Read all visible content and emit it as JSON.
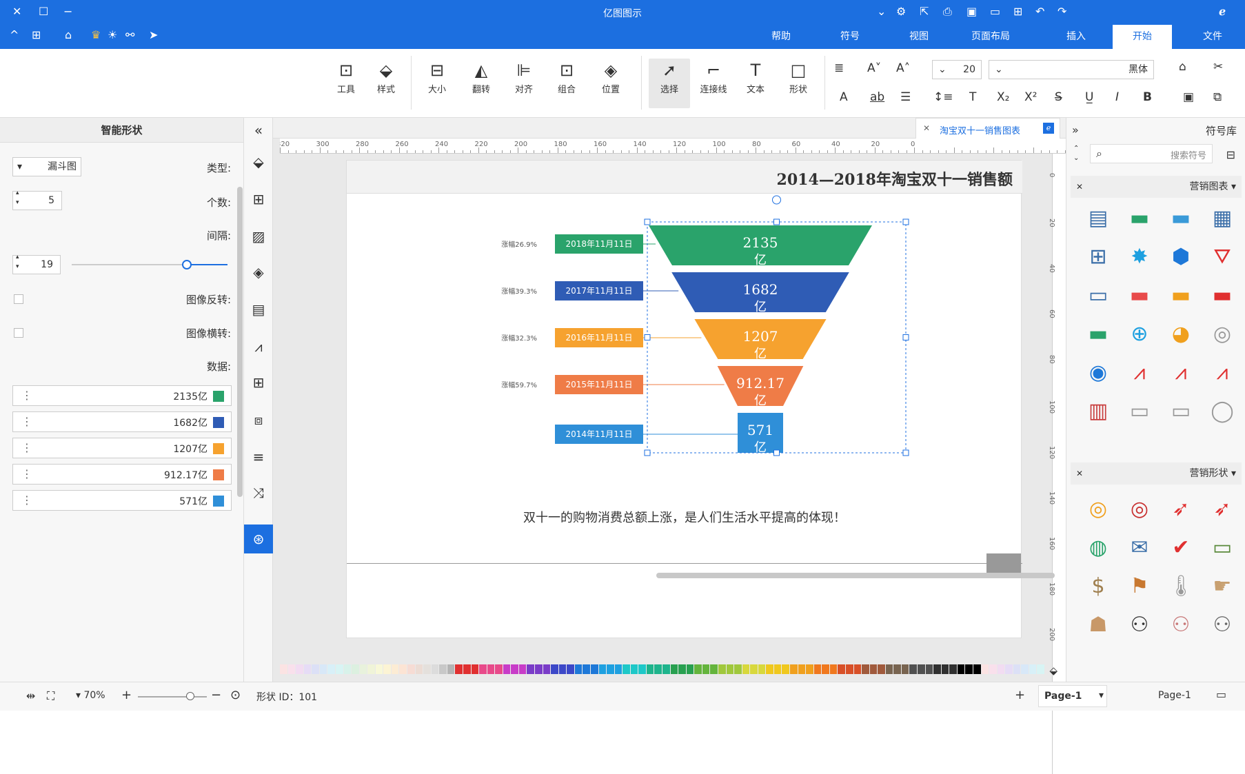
{
  "app": {
    "title": "亿图图示"
  },
  "menu": {
    "tabs": [
      "文件",
      "开始",
      "插入",
      "页面布局",
      "视图",
      "符号",
      "帮助"
    ],
    "active": "开始"
  },
  "toolbar": {
    "font_name": "黑体",
    "font_size": "20",
    "tools": [
      "形状",
      "文本",
      "连接线",
      "选择",
      "位置",
      "组合",
      "对齐",
      "翻转",
      "大小",
      "样式",
      "工具"
    ],
    "selected": "选择"
  },
  "left_panel": {
    "title": "智能形状",
    "type_label": "类型:",
    "type_value": "漏斗图",
    "count_label": "个数:",
    "count_value": "5",
    "spacing_label": "间隔:",
    "spacing_value": "19",
    "spacing_fraction": 0.26,
    "flip_v_label": "图像反转:",
    "flip_h_label": "图像横转:",
    "data_label": "数据:",
    "data": [
      {
        "text": "2135亿",
        "color": "#2aa36b"
      },
      {
        "text": "1682亿",
        "color": "#2f5cb5"
      },
      {
        "text": "1207亿",
        "color": "#f6a22f"
      },
      {
        "text": "912.17亿",
        "color": "#ef7c47"
      },
      {
        "text": "571亿",
        "color": "#2f8fd8"
      }
    ]
  },
  "document": {
    "tab_title": "淘宝双十一销售图表"
  },
  "diagram": {
    "title": "2014—2018年淘宝双十一销售额",
    "footer": "双十一的购物消费总额上涨，是人们生活水平提高的体现！",
    "chart_data": {
      "type": "funnel",
      "categories": [
        "2018年11月11日",
        "2017年11月11日",
        "2016年11月11日",
        "2015年11月11日",
        "2014年11月11日"
      ],
      "values": [
        "2135",
        "1682",
        "1207",
        "912.17",
        "571"
      ],
      "unit": "亿",
      "notes": [
        "涨幅26.9%",
        "涨幅39.3%",
        "涨幅32.3%",
        "涨幅59.7%"
      ],
      "colors": [
        "#2aa36b",
        "#2f5cb5",
        "#f6a22f",
        "#ef7c47",
        "#2f8fd8"
      ]
    }
  },
  "right_panel": {
    "title": "符号库",
    "search_placeholder": "搜索符号",
    "sections": [
      {
        "title": "营销图表"
      },
      {
        "title": "营销形状"
      }
    ]
  },
  "status": {
    "page_name": "Page-1",
    "page_tab": "Page-1",
    "shape_id": "形状 ID：101",
    "zoom": "70%"
  },
  "ruler": {
    "h_ticks": [
      "0",
      "20",
      "40",
      "60",
      "80",
      "100",
      "120",
      "140",
      "160",
      "180",
      "200",
      "220",
      "240",
      "260",
      "280",
      "300",
      "320"
    ],
    "v_ticks": [
      "0",
      "20",
      "40",
      "60",
      "80",
      "100",
      "120",
      "140",
      "160",
      "180",
      "200"
    ]
  }
}
